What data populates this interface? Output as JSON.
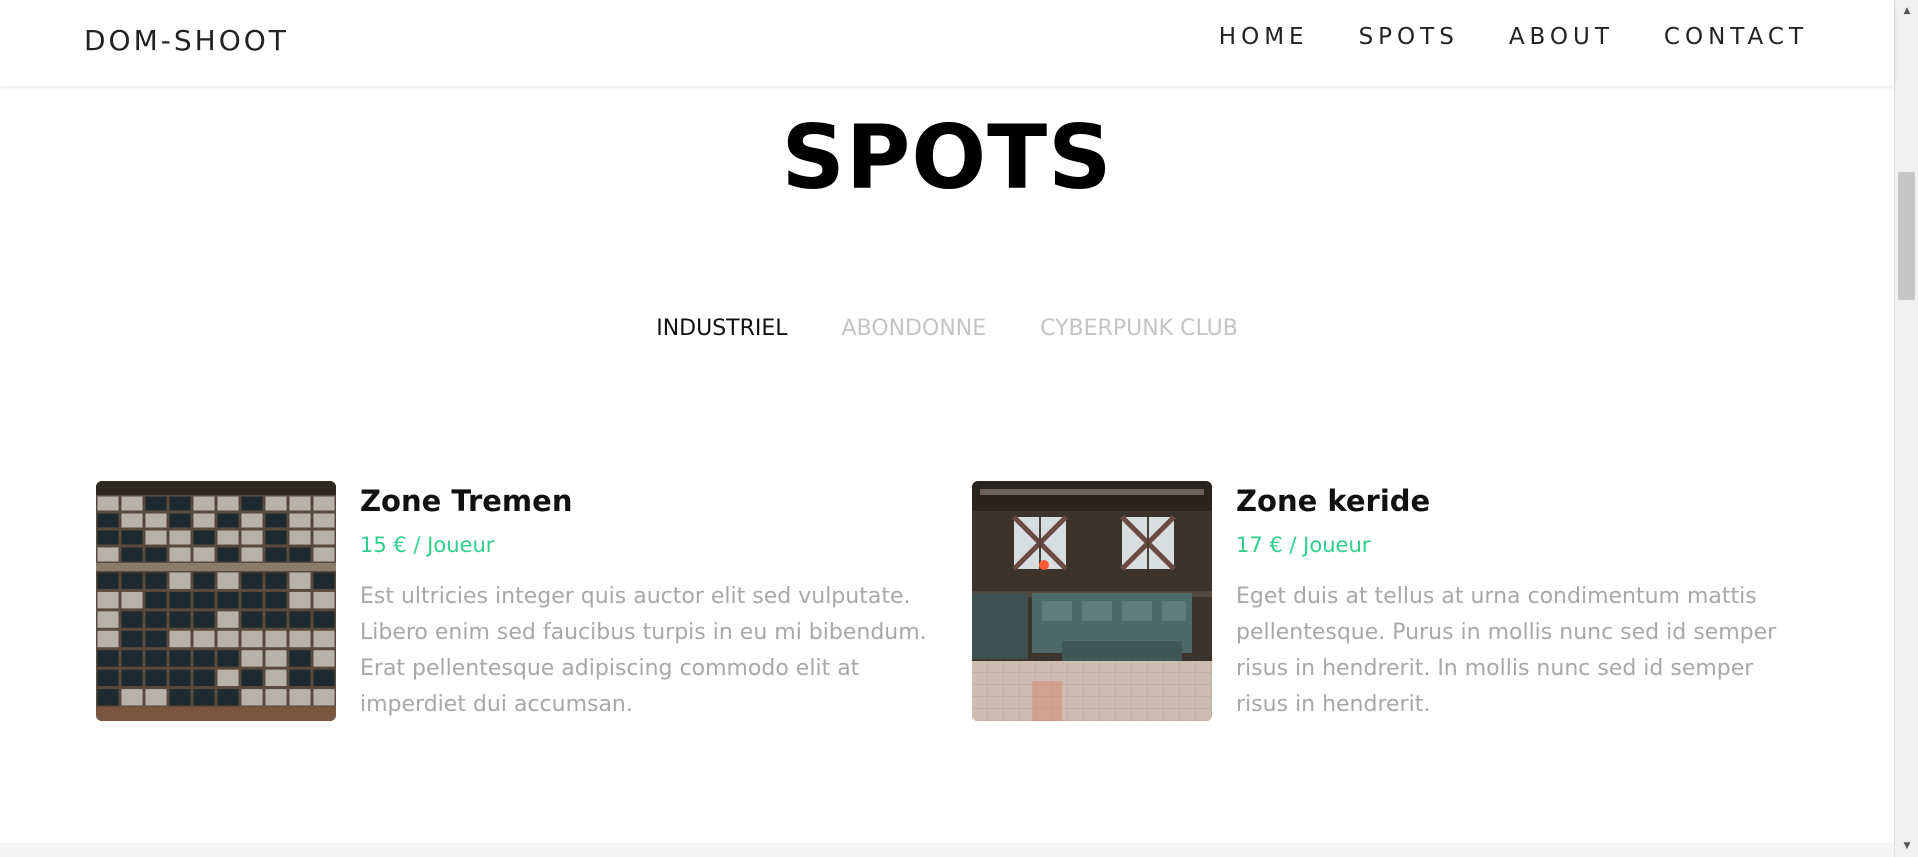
{
  "header": {
    "brand": "DOM-SHOOT",
    "nav": [
      "HOME",
      "SPOTS",
      "ABOUT",
      "CONTACT"
    ]
  },
  "main": {
    "title": "SPOTS",
    "filters": [
      {
        "label": "INDUSTRIEL",
        "active": true
      },
      {
        "label": "ABONDONNE",
        "active": false
      },
      {
        "label": "CYBERPUNK CLUB",
        "active": false
      }
    ],
    "cards": [
      {
        "title": "Zone Tremen",
        "price": "15 € / Joueur",
        "description": "Est ultricies integer quis auctor elit sed vulputate. Libero enim sed faucibus turpis in eu mi bibendum. Erat pellentesque adipiscing commodo elit at imperdiet dui accumsan.",
        "image": "broken-factory-windows-photo"
      },
      {
        "title": "Zone keride",
        "price": "17 € / Joueur",
        "description": "Eget duis at tellus at urna condimentum mattis pellentesque. Purus in mollis nunc sed id semper risus in hendrerit. In mollis nunc sed id semper risus in hendrerit.",
        "image": "industrial-control-room-photo"
      }
    ]
  },
  "colors": {
    "accent": "#2fd08a",
    "text": "#111111",
    "muted": "#a8a8a8",
    "filter_inactive": "#c4c4c4"
  },
  "icons": {
    "scroll_up": "scroll-up-arrow-icon",
    "scroll_down": "scroll-down-arrow-icon"
  }
}
